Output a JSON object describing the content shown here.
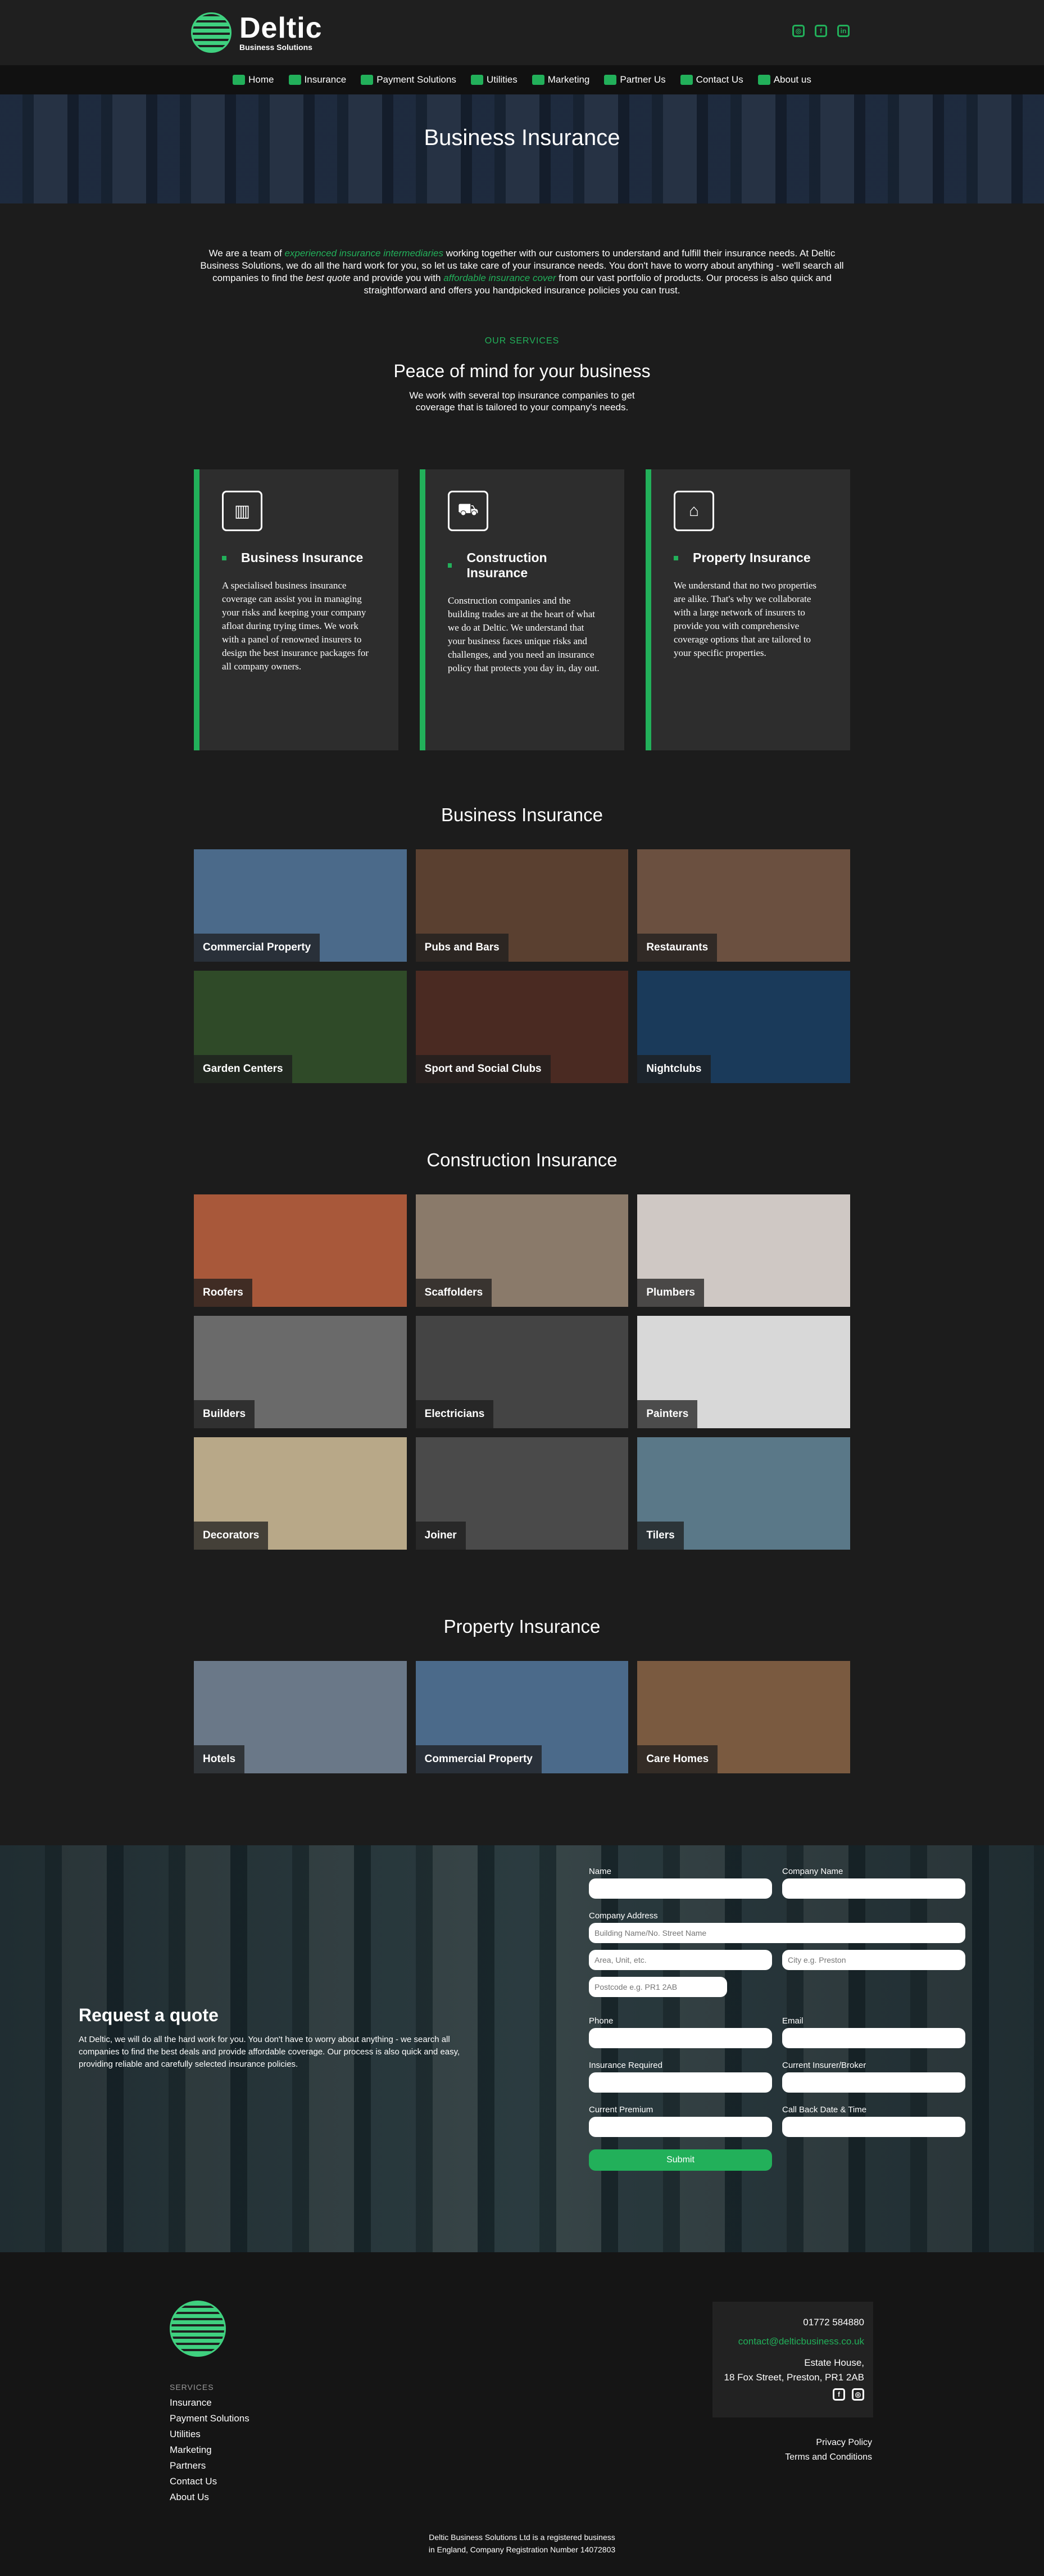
{
  "header": {
    "brand_name": "Deltic",
    "brand_sub": "Business Solutions",
    "socials": [
      "instagram-icon",
      "facebook-icon",
      "linkedin-icon"
    ]
  },
  "nav": [
    "Home",
    "Insurance",
    "Payment Solutions",
    "Utilities",
    "Marketing",
    "Partner Us",
    "Contact Us",
    "About us"
  ],
  "hero": {
    "title": "Business Insurance"
  },
  "intro": {
    "part1": "We are a team of ",
    "em1": "experienced insurance intermediaries",
    "part2": " working together with our customers to understand and fulfill their insurance needs. At Deltic Business Solutions, we do all the hard work for you, so let us take care of your insurance needs. You don't have to worry about anything - we'll search all companies to find the ",
    "em2": "best quote",
    "part3": " and provide you with ",
    "em3": "affordable insurance cover",
    "part4": " from our vast portfolio of products. Our process is also quick and straightforward and offers you handpicked insurance policies you can trust."
  },
  "services": {
    "eyebrow": "OUR SERVICES",
    "title": "Peace of mind for your business",
    "subtitle": "We work with several top insurance companies to get coverage that is tailored to your company's needs."
  },
  "cards": [
    {
      "title": "Business Insurance",
      "icon": "building-icon",
      "text": "A specialised business insurance coverage can assist you in managing your risks and keeping your company afloat during trying times. We work with a panel of renowned insurers to design the best insurance packages for all company owners."
    },
    {
      "title": "Construction Insurance",
      "icon": "truck-icon",
      "text": "Construction companies and the building trades are at the heart of what we do at Deltic. We understand that your business faces unique risks and challenges, and you need an insurance policy that protects you day in, day out."
    },
    {
      "title": "Property Insurance",
      "icon": "house-icon",
      "text": "We understand that no two properties are alike. That's why we collaborate with a large network of insurers to provide you with comprehensive coverage options that are tailored to your specific properties."
    }
  ],
  "business": {
    "title": "Business Insurance",
    "tiles": [
      "Commercial Property",
      "Pubs and Bars",
      "Restaurants",
      "Garden Centers",
      "Sport and Social Clubs",
      "Nightclubs"
    ]
  },
  "construction": {
    "title": "Construction Insurance",
    "tiles": [
      "Roofers",
      "Scaffolders",
      "Plumbers",
      "Builders",
      "Electricians",
      "Painters",
      "Decorators",
      "Joiner",
      "Tilers"
    ]
  },
  "property": {
    "title": "Property Insurance",
    "tiles": [
      "Hotels",
      "Commercial Property",
      "Care Homes"
    ]
  },
  "tile_colors": [
    "#4b6a8a",
    "#5a4030",
    "#6b5040",
    "#2f4a28",
    "#4a2a22",
    "#1a3a5a",
    "#a8583a",
    "#8a7a6a",
    "#cfc8c4",
    "#6a6a6a",
    "#444",
    "#d8d8d8",
    "#b8a888",
    "#4a4a4a",
    "#5a7888",
    "#6a7888",
    "#4b6a8a",
    "#7a5a40"
  ],
  "quote": {
    "title": "Request a quote",
    "text": "At Deltic, we will do all the hard work for you. You don't have to worry about anything - we search all companies to find the best deals and provide affordable coverage. Our process is also quick and easy, providing reliable and carefully selected insurance policies.",
    "labels": {
      "name": "Name",
      "company": "Company Name",
      "address": "Company Address",
      "phone": "Phone",
      "email": "Email",
      "insurance": "Insurance Required",
      "insurer": "Current Insurer/Broker",
      "premium": "Current Premium",
      "callback": "Call Back Date & Time"
    },
    "placeholders": {
      "street": "Building Name/No. Street Name",
      "town": "Area, Unit, etc.",
      "city": "City e.g. Preston",
      "postcode": "Postcode e.g. PR1 2AB"
    },
    "submit": "Submit"
  },
  "footer": {
    "services_label": "SERVICES",
    "links": [
      "Insurance",
      "Payment Solutions",
      "Utilities",
      "Marketing",
      "Partners",
      "Contact Us",
      "About Us"
    ],
    "phone": "01772 584880",
    "email": "contact@delticbusiness.co.uk",
    "address1": "Estate House,",
    "address2": "18 Fox Street, Preston, PR1 2AB",
    "privacy": "Privacy Policy",
    "terms": "Terms and Conditions",
    "copy1": "Deltic Business Solutions Ltd is a registered business",
    "copy2": "in England, Company Registration Number 14072803"
  }
}
